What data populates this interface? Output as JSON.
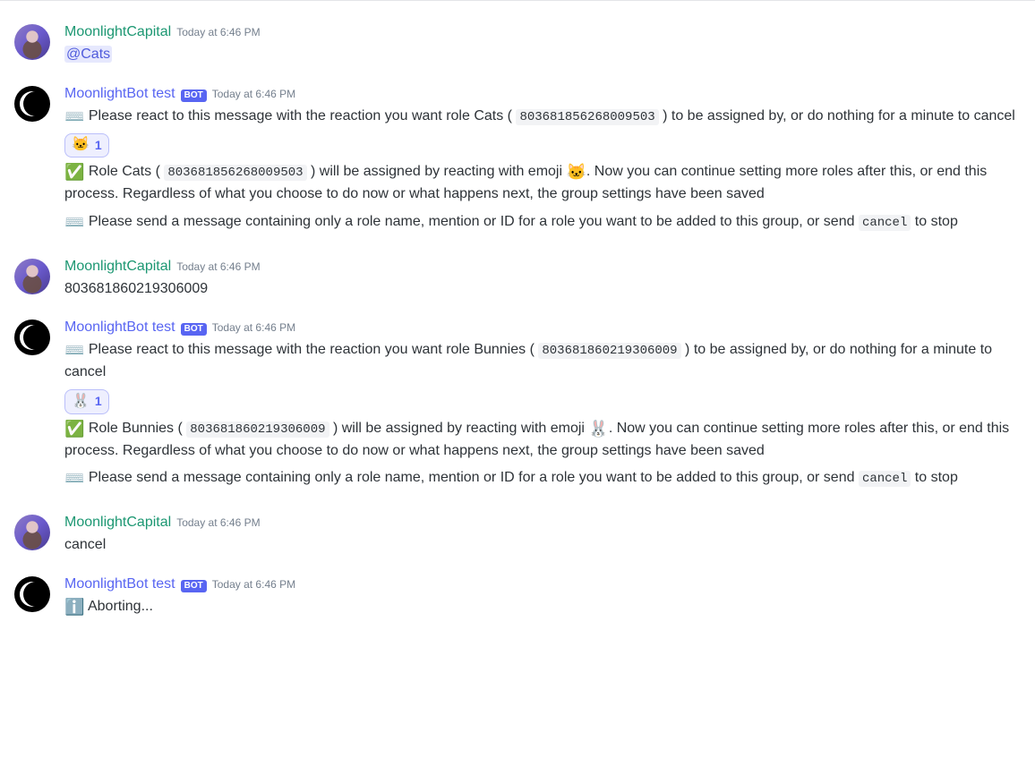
{
  "users": {
    "user": {
      "name": "MoonlightCapital"
    },
    "bot": {
      "name": "MoonlightBot test",
      "tag": "BOT"
    }
  },
  "timestamps": {
    "t": "Today at 6:46 PM"
  },
  "emojis": {
    "keyboard": "⌨️",
    "check": "✅",
    "cat": "🐱",
    "bunny": "🐰",
    "info": "ℹ️"
  },
  "msg1": {
    "mention": "@Cats"
  },
  "msg2": {
    "p1a": " Please react to this message with the reaction you want role Cats ( ",
    "p1_code": "803681856268009503",
    "p1b": " ) to be assigned by, or do nothing for a minute to cancel",
    "reaction_count": "1",
    "p2a": " Role Cats ( ",
    "p2_code": "803681856268009503",
    "p2b": " ) will be assigned by reacting with emoji ",
    "p2c": ". Now you can continue setting more roles after this, or end this process. Regardless of what you choose to do now or what happens next, the group settings have been saved",
    "p3a": " Please send a message containing only a role name, mention or ID for a role you want to be added to this group, or send ",
    "p3_code": "cancel",
    "p3b": " to stop"
  },
  "msg3": {
    "body": "803681860219306009"
  },
  "msg4": {
    "p1a": " Please react to this message with the reaction you want role Bunnies ( ",
    "p1_code": "803681860219306009",
    "p1b": " ) to be assigned by, or do nothing for a minute to cancel",
    "reaction_count": "1",
    "p2a": " Role Bunnies ( ",
    "p2_code": "803681860219306009",
    "p2b": " ) will be assigned by reacting with emoji ",
    "p2c": ". Now you can continue setting more roles after this, or end this process. Regardless of what you choose to do now or what happens next, the group settings have been saved",
    "p3a": " Please send a message containing only a role name, mention or ID for a role you want to be added to this group, or send ",
    "p3_code": "cancel",
    "p3b": " to stop"
  },
  "msg5": {
    "body": "cancel"
  },
  "msg6": {
    "body": " Aborting..."
  }
}
